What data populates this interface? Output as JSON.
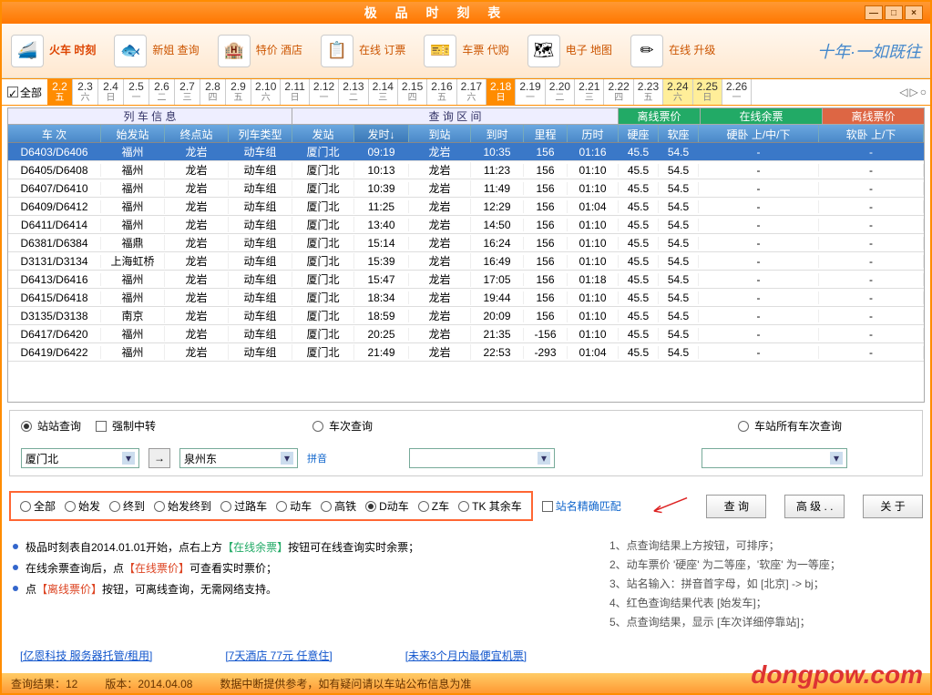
{
  "title": "极 品 时 刻 表",
  "toolbar": [
    {
      "label": "火车\n时刻",
      "icon": "🚄",
      "active": true
    },
    {
      "label": "新姐\n查询",
      "icon": "🐟"
    },
    {
      "label": "特价\n酒店",
      "icon": "🏨"
    },
    {
      "label": "在线\n订票",
      "icon": "📋"
    },
    {
      "label": "车票\n代购",
      "icon": "🎫"
    },
    {
      "label": "电子\n地图",
      "icon": "🗺"
    },
    {
      "label": "在线\n升级",
      "icon": "✏"
    }
  ],
  "brand": "十年·一如既往",
  "date_all_label": "全部",
  "dates": [
    {
      "d": "2.2",
      "w": "五",
      "hl": true
    },
    {
      "d": "2.3",
      "w": "六"
    },
    {
      "d": "2.4",
      "w": "日"
    },
    {
      "d": "2.5",
      "w": "一"
    },
    {
      "d": "2.6",
      "w": "二"
    },
    {
      "d": "2.7",
      "w": "三"
    },
    {
      "d": "2.8",
      "w": "四"
    },
    {
      "d": "2.9",
      "w": "五"
    },
    {
      "d": "2.10",
      "w": "六"
    },
    {
      "d": "2.11",
      "w": "日"
    },
    {
      "d": "2.12",
      "w": "一"
    },
    {
      "d": "2.13",
      "w": "二"
    },
    {
      "d": "2.14",
      "w": "三"
    },
    {
      "d": "2.15",
      "w": "四"
    },
    {
      "d": "2.16",
      "w": "五"
    },
    {
      "d": "2.17",
      "w": "六"
    },
    {
      "d": "2.18",
      "w": "日",
      "hl": true
    },
    {
      "d": "2.19",
      "w": "一"
    },
    {
      "d": "2.20",
      "w": "二"
    },
    {
      "d": "2.21",
      "w": "三"
    },
    {
      "d": "2.22",
      "w": "四"
    },
    {
      "d": "2.23",
      "w": "五"
    },
    {
      "d": "2.24",
      "w": "六",
      "yel": true
    },
    {
      "d": "2.25",
      "w": "日",
      "yel": true
    },
    {
      "d": "2.26",
      "w": "一"
    }
  ],
  "grid": {
    "group1": "列 车 信 息",
    "group2": "查 询 区 间",
    "group3": "离线票价",
    "group4": "在线余票",
    "group5": "离线票价",
    "cols": {
      "num": "车 次",
      "start": "始发站",
      "end": "终点站",
      "type": "列车类型",
      "dep": "发站",
      "deptime": "发时↓",
      "arr": "到站",
      "arrtime": "到时",
      "dist": "里程",
      "dur": "历时",
      "hard": "硬座",
      "soft": "软座",
      "hsu": "硬卧 上/中/下",
      "sup": "软卧 上/下"
    },
    "rows": [
      {
        "num": "D6403/D6406",
        "start": "福州",
        "end": "龙岩",
        "type": "动车组",
        "dep": "厦门北",
        "deptime": "09:19",
        "arr": "龙岩",
        "arrtime": "10:35",
        "dist": "156",
        "dur": "01:16",
        "hard": "45.5",
        "soft": "54.5",
        "hsu": "-",
        "sup": "-",
        "sel": true
      },
      {
        "num": "D6405/D6408",
        "start": "福州",
        "end": "龙岩",
        "type": "动车组",
        "dep": "厦门北",
        "deptime": "10:13",
        "arr": "龙岩",
        "arrtime": "11:23",
        "dist": "156",
        "dur": "01:10",
        "hard": "45.5",
        "soft": "54.5",
        "hsu": "-",
        "sup": "-"
      },
      {
        "num": "D6407/D6410",
        "start": "福州",
        "end": "龙岩",
        "type": "动车组",
        "dep": "厦门北",
        "deptime": "10:39",
        "arr": "龙岩",
        "arrtime": "11:49",
        "dist": "156",
        "dur": "01:10",
        "hard": "45.5",
        "soft": "54.5",
        "hsu": "-",
        "sup": "-"
      },
      {
        "num": "D6409/D6412",
        "start": "福州",
        "end": "龙岩",
        "type": "动车组",
        "dep": "厦门北",
        "deptime": "11:25",
        "arr": "龙岩",
        "arrtime": "12:29",
        "dist": "156",
        "dur": "01:04",
        "hard": "45.5",
        "soft": "54.5",
        "hsu": "-",
        "sup": "-"
      },
      {
        "num": "D6411/D6414",
        "start": "福州",
        "end": "龙岩",
        "type": "动车组",
        "dep": "厦门北",
        "deptime": "13:40",
        "arr": "龙岩",
        "arrtime": "14:50",
        "dist": "156",
        "dur": "01:10",
        "hard": "45.5",
        "soft": "54.5",
        "hsu": "-",
        "sup": "-"
      },
      {
        "num": "D6381/D6384",
        "start": "福鼎",
        "end": "龙岩",
        "type": "动车组",
        "dep": "厦门北",
        "deptime": "15:14",
        "arr": "龙岩",
        "arrtime": "16:24",
        "dist": "156",
        "dur": "01:10",
        "hard": "45.5",
        "soft": "54.5",
        "hsu": "-",
        "sup": "-"
      },
      {
        "num": "D3131/D3134",
        "start": "上海虹桥",
        "end": "龙岩",
        "type": "动车组",
        "dep": "厦门北",
        "deptime": "15:39",
        "arr": "龙岩",
        "arrtime": "16:49",
        "dist": "156",
        "dur": "01:10",
        "hard": "45.5",
        "soft": "54.5",
        "hsu": "-",
        "sup": "-"
      },
      {
        "num": "D6413/D6416",
        "start": "福州",
        "end": "龙岩",
        "type": "动车组",
        "dep": "厦门北",
        "deptime": "15:47",
        "arr": "龙岩",
        "arrtime": "17:05",
        "dist": "156",
        "dur": "01:18",
        "hard": "45.5",
        "soft": "54.5",
        "hsu": "-",
        "sup": "-"
      },
      {
        "num": "D6415/D6418",
        "start": "福州",
        "end": "龙岩",
        "type": "动车组",
        "dep": "厦门北",
        "deptime": "18:34",
        "arr": "龙岩",
        "arrtime": "19:44",
        "dist": "156",
        "dur": "01:10",
        "hard": "45.5",
        "soft": "54.5",
        "hsu": "-",
        "sup": "-"
      },
      {
        "num": "D3135/D3138",
        "start": "南京",
        "end": "龙岩",
        "type": "动车组",
        "dep": "厦门北",
        "deptime": "18:59",
        "arr": "龙岩",
        "arrtime": "20:09",
        "dist": "156",
        "dur": "01:10",
        "hard": "45.5",
        "soft": "54.5",
        "hsu": "-",
        "sup": "-"
      },
      {
        "num": "D6417/D6420",
        "start": "福州",
        "end": "龙岩",
        "type": "动车组",
        "dep": "厦门北",
        "deptime": "20:25",
        "arr": "龙岩",
        "arrtime": "21:35",
        "dist": "-156",
        "dur": "01:10",
        "hard": "45.5",
        "soft": "54.5",
        "hsu": "-",
        "sup": "-"
      },
      {
        "num": "D6419/D6422",
        "start": "福州",
        "end": "龙岩",
        "type": "动车组",
        "dep": "厦门北",
        "deptime": "21:49",
        "arr": "龙岩",
        "arrtime": "22:53",
        "dist": "-293",
        "dur": "01:04",
        "hard": "45.5",
        "soft": "54.5",
        "hsu": "-",
        "sup": "-"
      }
    ]
  },
  "query": {
    "r_station": "站站查询",
    "chk_transfer": "强制中转",
    "r_train": "车次查询",
    "r_allstation": "车站所有车次查询",
    "from": "厦门北",
    "to": "泉州东",
    "swap_hint": "拼音"
  },
  "filters": [
    "全部",
    "始发",
    "终到",
    "始发终到",
    "过路车",
    "动车",
    "高铁",
    "D动车",
    "Z车",
    "TK 其余车"
  ],
  "filter_selected": 7,
  "chk_accurate": "站名精确匹配",
  "btn_query": "查 询",
  "btn_adv": "高 级 . .",
  "btn_about": "关 于",
  "tips_left": [
    {
      "pre": "极品时刻表自2014.01.01开始，点右上方",
      "hl": "【在线余票】",
      "cls": "hl1",
      "post": "按钮可在线查询实时余票；"
    },
    {
      "pre": "在线余票查询后，点",
      "hl": "【在线票价】",
      "cls": "hl2",
      "post": "可查看实时票价；"
    },
    {
      "pre": "点",
      "hl": "【离线票价】",
      "cls": "hl2",
      "post": "按钮，可离线查询，无需网络支持。"
    }
  ],
  "tips_right": [
    "1、点查询结果上方按钮，可排序；",
    "2、动车票价 '硬座' 为二等座，'软座' 为一等座；",
    "3、站名输入：拼音首字母，如 [北京] -> bj；",
    "4、红色查询结果代表 [始发车]；",
    "5、点查询结果，显示 [车次详细停靠站]；"
  ],
  "links": [
    "[亿恩科技 服务器托管/租用]",
    "[7天酒店 77元 任意住]",
    "[未来3个月内最便宜机票]"
  ],
  "status": {
    "result": "查询结果：12",
    "version": "版本：2014.04.08",
    "msg": "数据中断提供参考，如有疑问请以车站公布信息为准"
  },
  "watermark": "dongpow.com"
}
